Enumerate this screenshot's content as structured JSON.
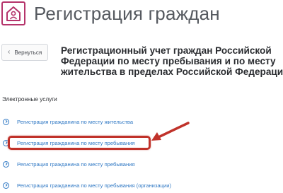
{
  "header": {
    "title": "Регистрация граждан",
    "logo_icon": "house-person-icon",
    "accent_color": "#b5346b"
  },
  "back_button": {
    "label": "Вернуться",
    "icon": "chevron-left-icon"
  },
  "main": {
    "heading": "Регистрационный учет граждан Российской Федерации по месту пребывания и по месту жительства в пределах Российской Федерации",
    "section_title": "Электронные услуги",
    "services": [
      {
        "label": "Регистрация гражданина по месту жительства",
        "icon": "chevron-right-circle-icon"
      },
      {
        "label": "Регистрация гражданина по месту пребывания",
        "icon": "chevron-right-circle-icon",
        "highlighted": true
      },
      {
        "label": "Регистрация гражданина по месту пребывания",
        "icon": "chevron-right-circle-icon"
      },
      {
        "label": "Регистрация гражданина по месту пребывания (организации)",
        "icon": "chevron-right-circle-icon"
      }
    ]
  },
  "annotation": {
    "highlight_color": "#c0322a",
    "arrow_icon": "red-arrow-icon"
  },
  "link_color": "#2f78c4"
}
